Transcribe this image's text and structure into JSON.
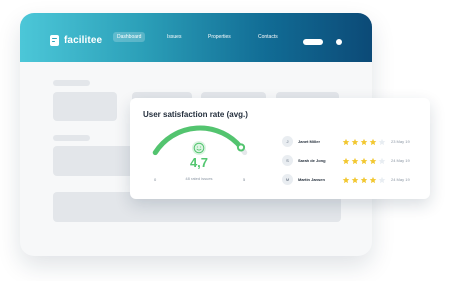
{
  "app": {
    "logo_text": "facilitee"
  },
  "nav": {
    "items": [
      {
        "label": "Dashboard",
        "active": true
      },
      {
        "label": "Issues",
        "active": false
      },
      {
        "label": "Properties",
        "active": false
      },
      {
        "label": "Contacts",
        "active": false
      }
    ]
  },
  "card": {
    "title": "User satisfaction rate (avg.)",
    "score": "4,7",
    "rated_issues": "48 rated issues",
    "range_min": "0",
    "range_max": "5",
    "gauge_fraction": 0.94,
    "colors": {
      "primary": "#53c46f",
      "track": "#e5e8eb",
      "star": "#f2c832",
      "star_empty": "#e8edf2"
    }
  },
  "reviews": [
    {
      "initial": "J",
      "name": "Janet Miller",
      "rating": 4,
      "date": "23 May 19"
    },
    {
      "initial": "S",
      "name": "Sarah de Jong",
      "rating": 4,
      "date": "24 May 19"
    },
    {
      "initial": "M",
      "name": "Martin Jansen",
      "rating": 4,
      "date": "24 May 19"
    }
  ],
  "icons": {
    "logo": "facilitee-logo-icon",
    "gauge_center": "smile-icon",
    "rating": "star-icon"
  }
}
